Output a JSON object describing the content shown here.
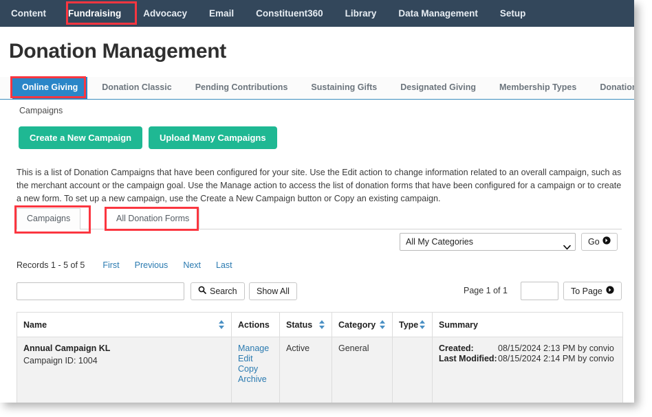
{
  "topnav": {
    "items": [
      {
        "label": "Content",
        "active": false
      },
      {
        "label": "Fundraising",
        "active": true
      },
      {
        "label": "Advocacy",
        "active": false
      },
      {
        "label": "Email",
        "active": false
      },
      {
        "label": "Constituent360",
        "active": false
      },
      {
        "label": "Library",
        "active": false
      },
      {
        "label": "Data Management",
        "active": false
      },
      {
        "label": "Setup",
        "active": false
      }
    ]
  },
  "header": {
    "title": "Donation Management"
  },
  "tabs": [
    {
      "label": "Online Giving",
      "active": true
    },
    {
      "label": "Donation Classic",
      "active": false
    },
    {
      "label": "Pending Contributions",
      "active": false
    },
    {
      "label": "Sustaining Gifts",
      "active": false
    },
    {
      "label": "Designated Giving",
      "active": false
    },
    {
      "label": "Membership Types",
      "active": false
    },
    {
      "label": "Donation",
      "active": false
    }
  ],
  "breadcrumb": "Campaigns",
  "actions": {
    "create_campaign": "Create a New Campaign",
    "upload_campaigns": "Upload Many Campaigns"
  },
  "description": "This is a list of Donation Campaigns that have been configured for your site. Use the Edit action to change information related to an overall campaign, such as the merchant account or the campaign goal. Use the Manage action to access the list of donation forms that have been configured for a campaign or to create a new form. To set up a new campaign, use the Create a New Campaign button or Copy an existing campaign.",
  "subtabs": [
    {
      "label": "Campaigns",
      "active": true
    },
    {
      "label": "All Donation Forms",
      "active": false
    }
  ],
  "filter": {
    "category_selected": "All My Categories",
    "go_label": "Go"
  },
  "pagination": {
    "records_label": "Records 1 - 5 of 5",
    "first": "First",
    "previous": "Previous",
    "next": "Next",
    "last": "Last",
    "page_of": "Page 1 of 1",
    "page_input_value": "",
    "to_page_label": "To Page"
  },
  "search": {
    "value": "",
    "placeholder": "",
    "search_label": "Search",
    "show_all_label": "Show All"
  },
  "table": {
    "columns": [
      {
        "label": "Name",
        "sortable": true
      },
      {
        "label": "Actions",
        "sortable": false
      },
      {
        "label": "Status",
        "sortable": true
      },
      {
        "label": "Category",
        "sortable": true
      },
      {
        "label": "Type",
        "sortable": true
      },
      {
        "label": "Summary",
        "sortable": false
      }
    ],
    "rows": [
      {
        "name": "Annual Campaign KL",
        "campaign_id": "Campaign ID: 1004",
        "actions": [
          "Manage",
          "Edit",
          "Copy",
          "Archive"
        ],
        "status": "Active",
        "category": "General",
        "type": "",
        "summary": {
          "created_label": "Created:",
          "created_value": "08/15/2024 2:13 PM by convio",
          "modified_label": "Last Modified:",
          "modified_value": "08/15/2024 2:14 PM by convio"
        }
      }
    ]
  },
  "colors": {
    "nav_bg": "#33475b",
    "accent_blue": "#2a86c8",
    "green_button": "#1fb893",
    "link_blue": "#2a7ab0",
    "annotation_red": "#fb3640"
  }
}
